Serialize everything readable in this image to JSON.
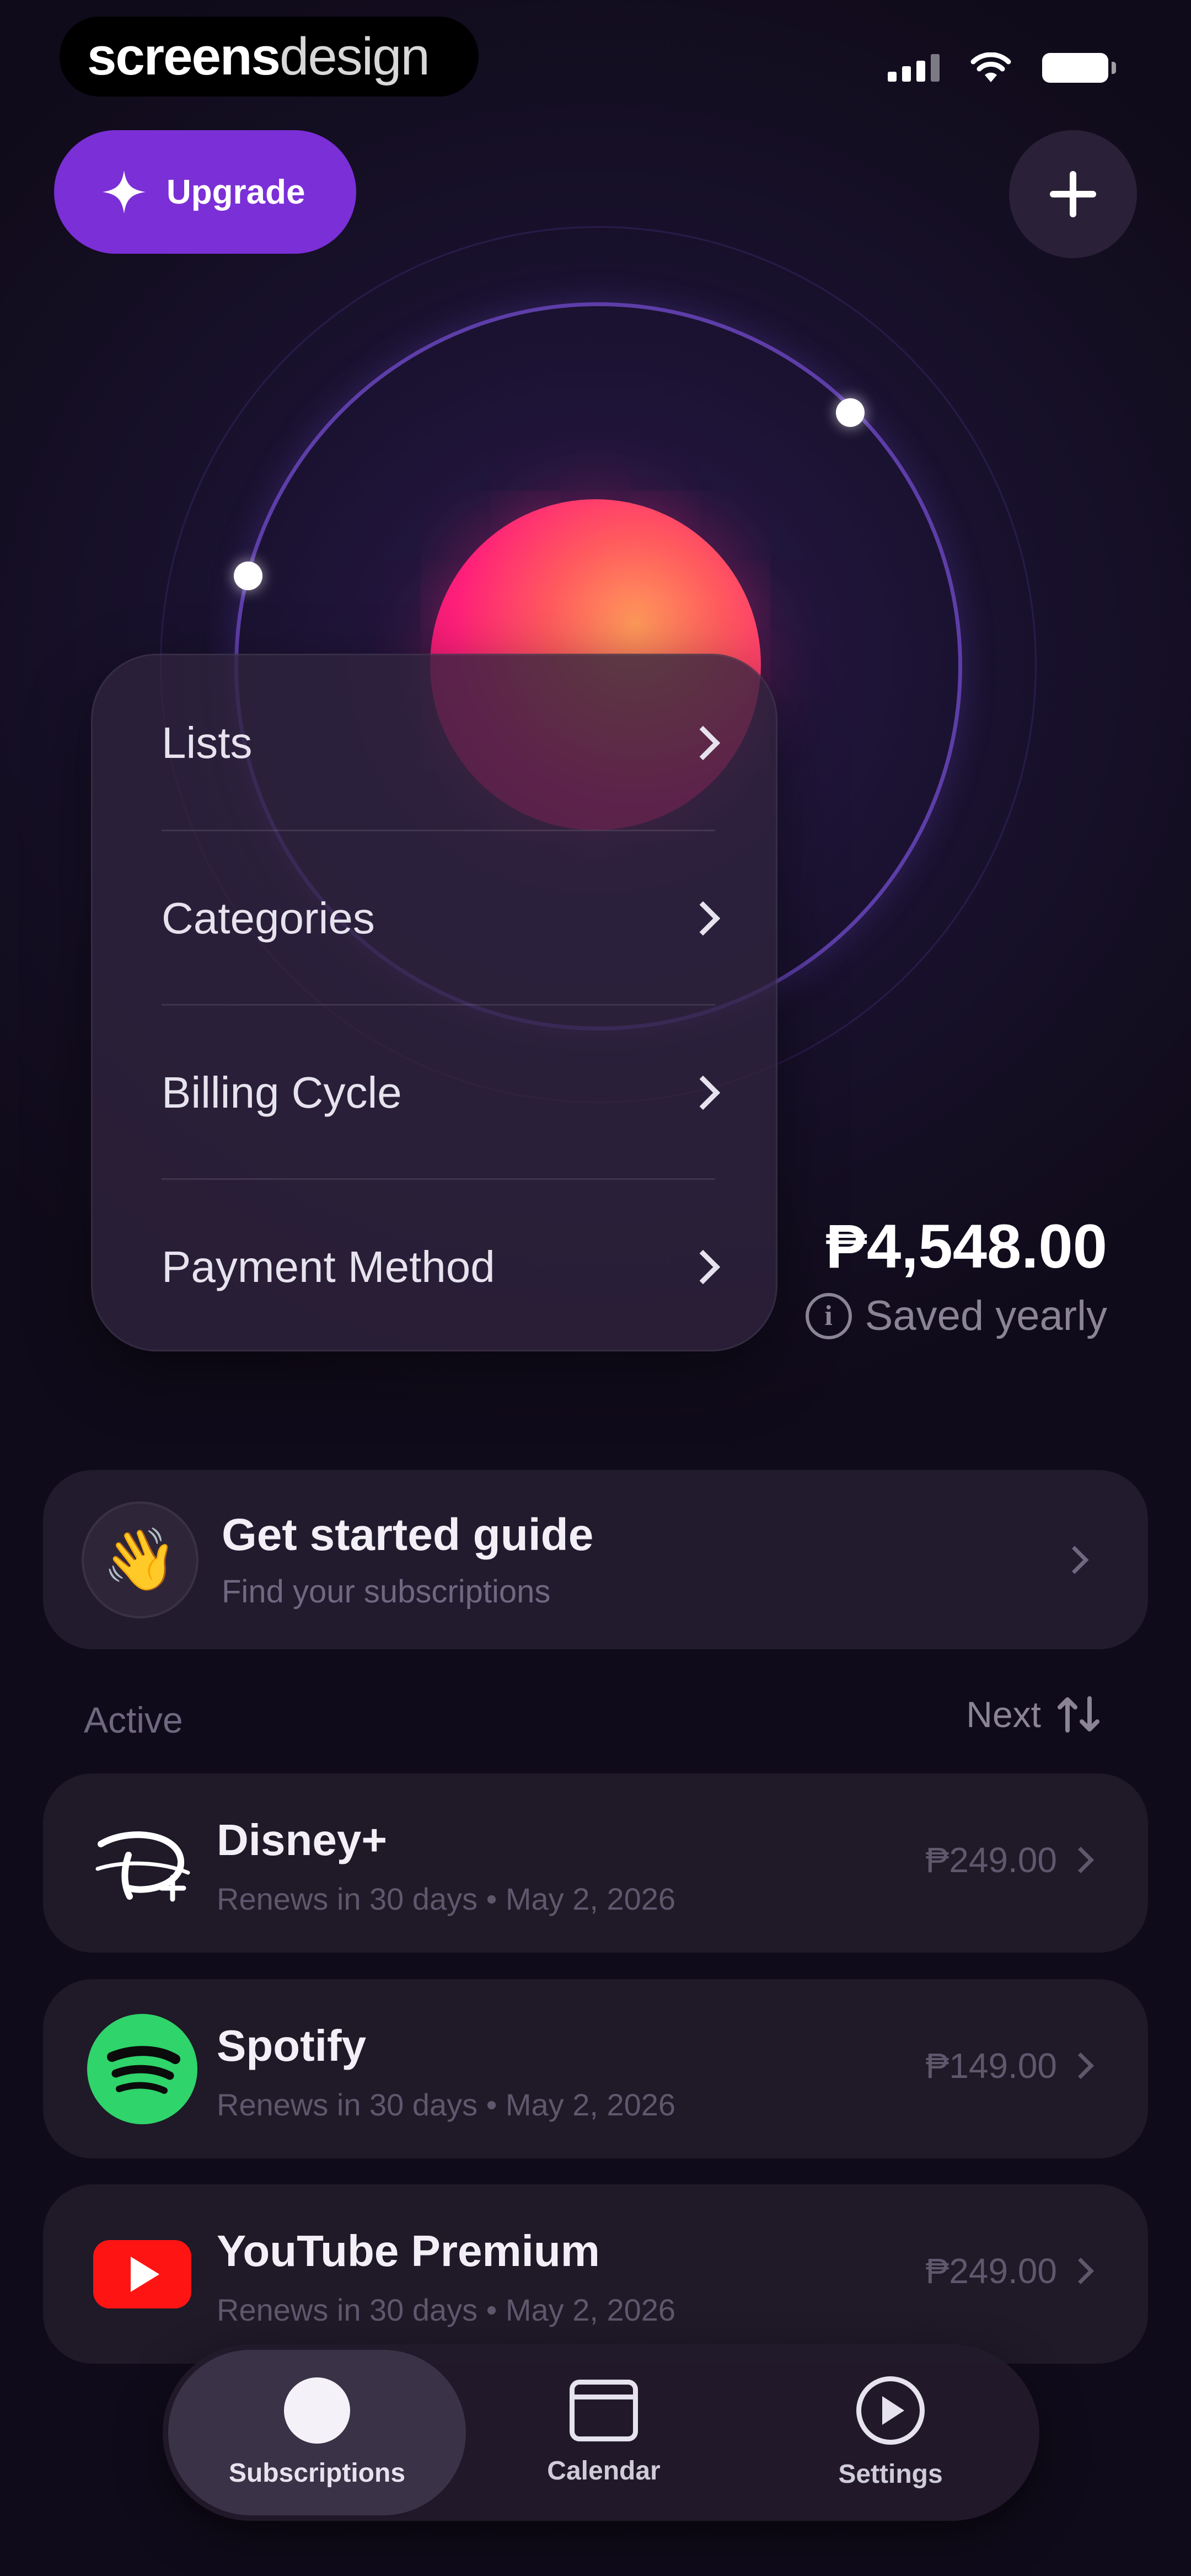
{
  "status_bar": {
    "brand_part1": "screens",
    "brand_part2": "design"
  },
  "header": {
    "upgrade_label": "Upgrade",
    "add_icon": "plus-icon"
  },
  "menu": {
    "items": [
      {
        "label": "Lists"
      },
      {
        "label": "Categories"
      },
      {
        "label": "Billing Cycle"
      },
      {
        "label": "Payment Method"
      }
    ]
  },
  "savings": {
    "amount": "₱4,548.00",
    "label": "Saved yearly"
  },
  "guide": {
    "title": "Get started guide",
    "subtitle": "Find your subscriptions",
    "icon": "👋"
  },
  "section": {
    "active_label": "Active",
    "sort_label": "Next"
  },
  "subscriptions": [
    {
      "name": "Disney+",
      "meta": "Renews in 30 days • May 2, 2026",
      "price": "₱249.00",
      "icon": "disney-plus-logo"
    },
    {
      "name": "Spotify",
      "meta": "Renews in 30 days • May 2, 2026",
      "price": "₱149.00",
      "icon": "spotify-logo"
    },
    {
      "name": "YouTube Premium",
      "meta": "Renews in 30 days • May 2, 2026",
      "price": "₱249.00",
      "icon": "youtube-logo"
    }
  ],
  "tabbar": {
    "tabs": [
      {
        "label": "Subscriptions",
        "icon": "circle-icon",
        "active": true
      },
      {
        "label": "Calendar",
        "icon": "calendar-icon",
        "active": false
      },
      {
        "label": "Settings",
        "icon": "settings-play-icon",
        "active": false
      }
    ]
  },
  "colors": {
    "accent": "#7b2fd6",
    "background": "#140e22",
    "planet": "#ff2f7a",
    "spotify": "#2fd46a",
    "youtube": "#ff1414"
  }
}
